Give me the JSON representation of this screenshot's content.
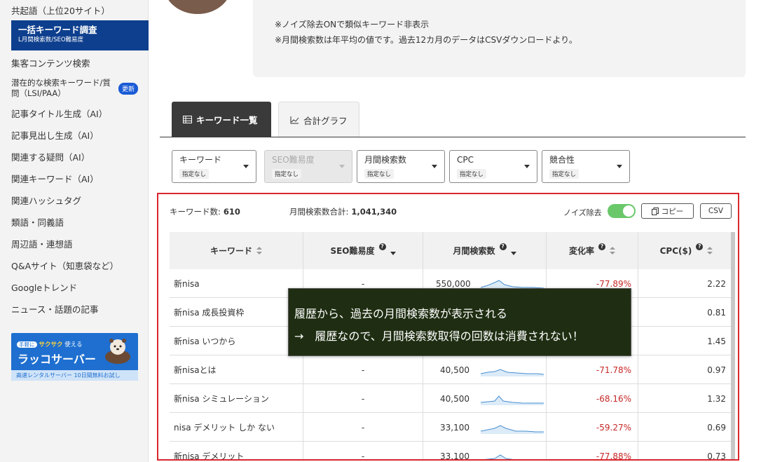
{
  "sidebar": {
    "items": [
      {
        "label": "共起語（上位20サイト）"
      },
      {
        "label": "集客コンテンツ検索"
      },
      {
        "label": "記事タイトル生成（AI）"
      },
      {
        "label": "記事見出し生成（AI）"
      },
      {
        "label": "関連する疑問（AI）"
      },
      {
        "label": "関連キーワード（AI）"
      },
      {
        "label": "関連ハッシュタグ"
      },
      {
        "label": "類語・同義語"
      },
      {
        "label": "周辺語・連想語"
      },
      {
        "label": "Q&Aサイト（知恵袋など）"
      },
      {
        "label": "Googleトレンド"
      },
      {
        "label": "ニュース・話題の記事"
      }
    ],
    "active": {
      "title": "一括キーワード調査",
      "subtitle": "L月間検索数/SEO難易度"
    },
    "multi": {
      "label": "潜在的な検索キーワード/質問（LSI/PAA）",
      "badge": "更新"
    },
    "banner": {
      "pill": "手軽に",
      "highlight": "サクサク",
      "tail": "使える",
      "title": "ラッコサーバー",
      "bottom": "高速レンタルサーバー 10日間無料お試し"
    }
  },
  "notes": [
    "※ノイズ除去ONで類似キーワード非表示",
    "※月間検索数は年平均の値です。過去12カ月のデータはCSVダウンロードより。"
  ],
  "tabs": [
    {
      "label": "キーワード一覧",
      "icon": "table-icon"
    },
    {
      "label": "合計グラフ",
      "icon": "line-chart-icon"
    }
  ],
  "filters": [
    {
      "label": "キーワード",
      "sub": "指定なし"
    },
    {
      "label": "SEO難易度",
      "sub": "指定なし"
    },
    {
      "label": "月間検索数",
      "sub": "指定なし"
    },
    {
      "label": "CPC",
      "sub": "指定なし"
    },
    {
      "label": "競合性",
      "sub": "指定なし"
    }
  ],
  "summary": {
    "kw_label": "キーワード数:",
    "kw_value": "610",
    "vol_label": "月間検索数合計:",
    "vol_value": "1,041,340",
    "noise_label": "ノイズ除去",
    "noise_on": true,
    "copy": "コピー",
    "csv": "CSV"
  },
  "table": {
    "headers": [
      "キーワード",
      "SEO難易度",
      "月間検索数",
      "変化率",
      "CPC($)"
    ],
    "rows": [
      {
        "keyword": "新nisa",
        "seo": "-",
        "volume": "550,000",
        "change": "-77.89%",
        "cpc": "2.22"
      },
      {
        "keyword": "新nisa 成長投資枠",
        "seo": "-",
        "volume": "",
        "change": "",
        "cpc": "0.81"
      },
      {
        "keyword": "新nisa いつから",
        "seo": "-",
        "volume": "",
        "change": "",
        "cpc": "1.45"
      },
      {
        "keyword": "新nisaとは",
        "seo": "-",
        "volume": "40,500",
        "change": "-71.78%",
        "cpc": "0.97"
      },
      {
        "keyword": "新nisa シミュレーション",
        "seo": "-",
        "volume": "40,500",
        "change": "-68.16%",
        "cpc": "1.32"
      },
      {
        "keyword": "nisa デメリット しか ない",
        "seo": "-",
        "volume": "33,100",
        "change": "-59.27%",
        "cpc": "0.69"
      },
      {
        "keyword": "新nisa デメリット",
        "seo": "-",
        "volume": "33,100",
        "change": "-77.88%",
        "cpc": "0.73"
      }
    ]
  },
  "tooltip": {
    "line1": "履歴から、過去の月間検索数が表示される",
    "line2": "→　履歴なので、月間検索数取得の回数は消費されない！"
  },
  "colors": {
    "accent": "#0e3f8e",
    "highlight_border": "#d9262c",
    "negative": "#c62828",
    "toggle_on": "#6ac86a",
    "tooltip_bg": "#1f2e12"
  }
}
